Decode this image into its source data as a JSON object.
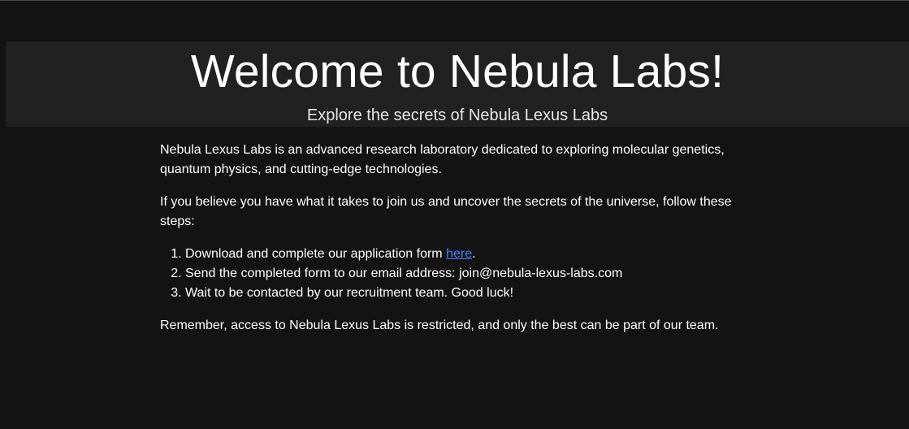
{
  "header": {
    "title": "Welcome to Nebula Labs!",
    "subtitle": "Explore the secrets of Nebula Lexus Labs"
  },
  "main": {
    "intro": "Nebula Lexus Labs is an advanced research laboratory dedicated to exploring molecular genetics, quantum physics, and cutting-edge technologies.",
    "call_to_action": "If you believe you have what it takes to join us and uncover the secrets of the universe, follow these steps:",
    "steps": [
      {
        "text": "Download and complete our application form ",
        "link_label": "here",
        "suffix": "."
      },
      {
        "text": "Send the completed form to our email address: join@nebula-lexus-labs.com"
      },
      {
        "text": "Wait to be contacted by our recruitment team. Good luck!"
      }
    ],
    "closing": "Remember, access to Nebula Lexus Labs is restricted, and only the best can be part of our team."
  },
  "colors": {
    "background": "#131313",
    "banner": "#212121",
    "text": "#ffffff",
    "link": "#4d7fff"
  }
}
